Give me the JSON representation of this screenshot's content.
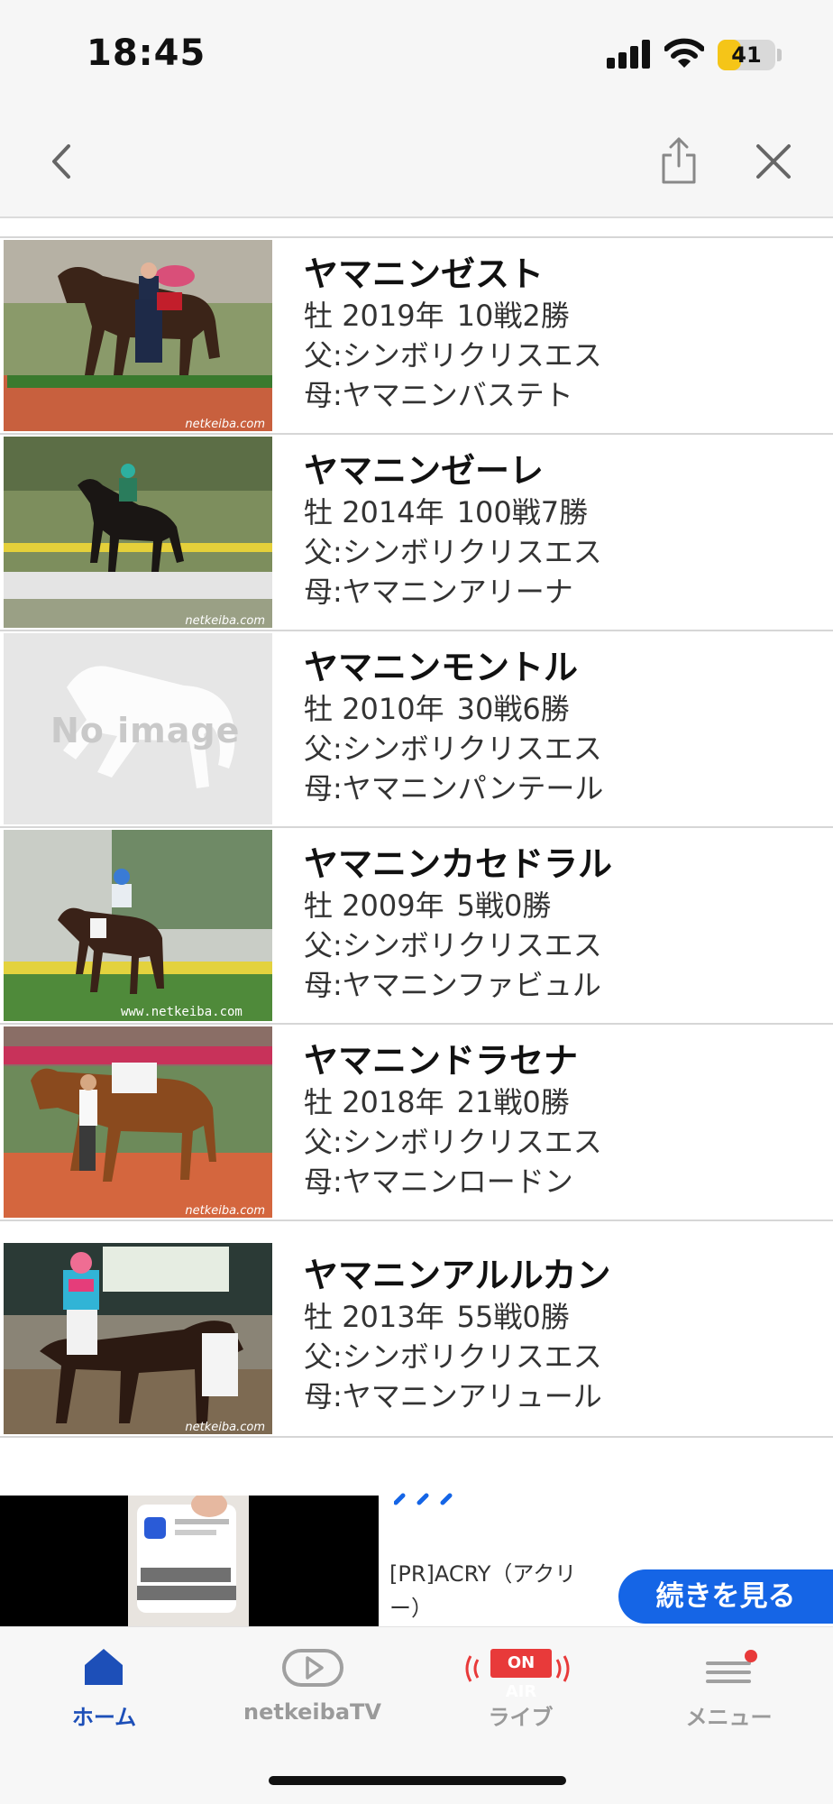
{
  "status_bar": {
    "time": "18:45",
    "battery": "41",
    "battery_level": 0.41
  },
  "nav": {
    "back_icon": "chevron-left-icon",
    "share_icon": "share-icon",
    "close_icon": "close-icon"
  },
  "horses": [
    {
      "name": "ヤマニンゼスト",
      "sex": "牡",
      "year": "2019年",
      "record": "10戦2勝",
      "sire": "父:シンボリクリスエス",
      "dam": "母:ヤマニンバステト",
      "photo": "photo"
    },
    {
      "name": "ヤマニンゼーレ",
      "sex": "牡",
      "year": "2014年",
      "record": "100戦7勝",
      "sire": "父:シンボリクリスエス",
      "dam": "母:ヤマニンアリーナ",
      "photo": "photo"
    },
    {
      "name": "ヤマニンモントル",
      "sex": "牡",
      "year": "2010年",
      "record": "30戦6勝",
      "sire": "父:シンボリクリスエス",
      "dam": "母:ヤマニンパンテール",
      "photo": "no-image",
      "no_image_text": "No image"
    },
    {
      "name": "ヤマニンカセドラル",
      "sex": "牡",
      "year": "2009年",
      "record": "5戦0勝",
      "sire": "父:シンボリクリスエス",
      "dam": "母:ヤマニンファビュル",
      "photo": "photo"
    },
    {
      "name": "ヤマニンドラセナ",
      "sex": "牡",
      "year": "2018年",
      "record": "21戦0勝",
      "sire": "父:シンボリクリスエス",
      "dam": "母:ヤマニンロードン",
      "photo": "photo"
    },
    {
      "name": "ヤマニンアルルカン",
      "sex": "牡",
      "year": "2013年",
      "record": "55戦0勝",
      "sire": "父:シンボリクリスエス",
      "dam": "母:ヤマニンアリュール",
      "photo": "photo"
    }
  ],
  "ad": {
    "sponsor": "[PR]ACRY（アクリー）",
    "cta": "続きを見る"
  },
  "tabs": [
    {
      "label": "ホーム",
      "icon": "home-icon",
      "active": true
    },
    {
      "label": "netkeibaTV",
      "icon": "play-icon",
      "active": false
    },
    {
      "label": "ライブ",
      "icon": "live-icon",
      "badge": "ON AIR",
      "active": false
    },
    {
      "label": "メニュー",
      "icon": "menu-icon",
      "active": false
    }
  ],
  "colors": {
    "accent": "#1d4fb8",
    "cta": "#1565e6",
    "onair": "#e83a3a",
    "battery": "#f5c518"
  }
}
